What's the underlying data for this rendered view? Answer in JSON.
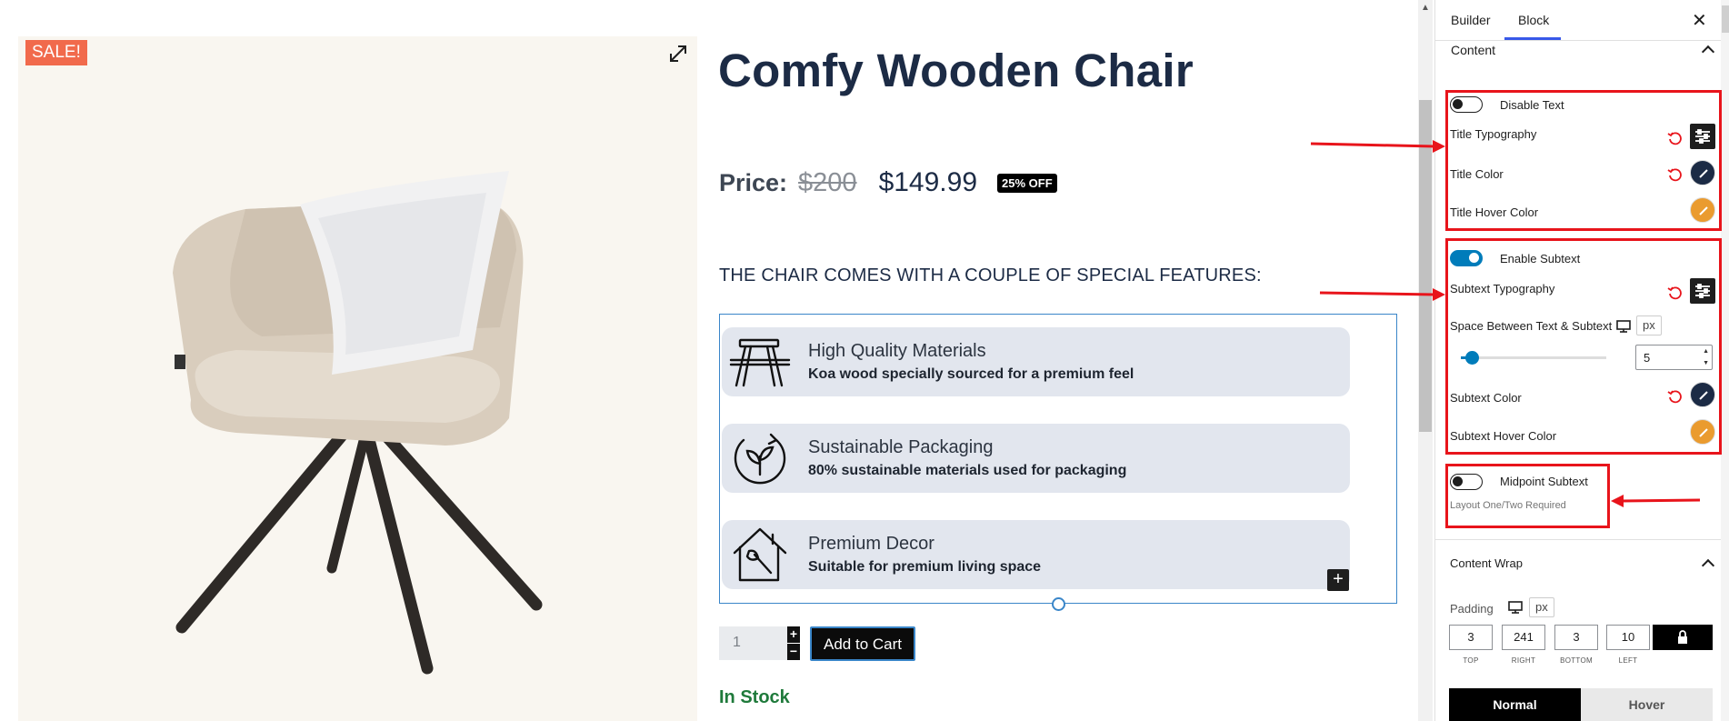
{
  "product": {
    "sale_badge": "SALE!",
    "title": "Comfy Wooden Chair",
    "price_label": "Price:",
    "old_price": "$200",
    "new_price": "$149.99",
    "discount_badge": "25% OFF",
    "features_heading": "THE CHAIR COMES WITH A COUPLE OF SPECIAL FEATURES:",
    "features": [
      {
        "icon": "picnic-table-icon",
        "title": "High Quality Materials",
        "subtitle": "Koa wood specially sourced for a premium feel"
      },
      {
        "icon": "recycle-leaf-icon",
        "title": "Sustainable Packaging",
        "subtitle": "80% sustainable materials used for packaging"
      },
      {
        "icon": "house-paintbrush-icon",
        "title": "Premium Decor",
        "subtitle": "Suitable for premium living space"
      }
    ],
    "quantity": "1",
    "qty_plus": "+",
    "qty_minus": "−",
    "add_to_cart": "Add to Cart",
    "stock_status": "In Stock",
    "add_block": "+"
  },
  "sidebar": {
    "tabs": {
      "builder": "Builder",
      "block": "Block"
    },
    "close": "✕",
    "content_panel": {
      "title": "Content",
      "disable_text_label": "Disable Text",
      "disable_text_on": false,
      "title_typography_label": "Title Typography",
      "title_color_label": "Title Color",
      "title_hover_color_label": "Title Hover Color",
      "enable_subtext_label": "Enable Subtext",
      "enable_subtext_on": true,
      "subtext_typography_label": "Subtext Typography",
      "space_label": "Space Between Text & Subtext",
      "space_unit": "px",
      "space_value": "5",
      "subtext_color_label": "Subtext Color",
      "subtext_hover_color_label": "Subtext Hover Color",
      "midpoint_subtext_label": "Midpoint Subtext",
      "midpoint_subtext_on": false,
      "midpoint_note": "Layout One/Two Required"
    },
    "content_wrap": {
      "title": "Content Wrap",
      "padding_label": "Padding",
      "padding_unit": "px",
      "padding": {
        "top": "3",
        "right": "241",
        "bottom": "3",
        "left": "10"
      },
      "captions": {
        "top": "TOP",
        "right": "RIGHT",
        "bottom": "BOTTOM",
        "left": "LEFT"
      },
      "state_normal": "Normal",
      "state_hover": "Hover"
    }
  },
  "colors": {
    "accent_blue": "#007cba",
    "annotation_red": "#e8141b",
    "title_color": "#1c2b45",
    "hover_color": "#ea9b2f",
    "sale_badge": "#f16a4c",
    "stock_green": "#1f7a3b"
  }
}
